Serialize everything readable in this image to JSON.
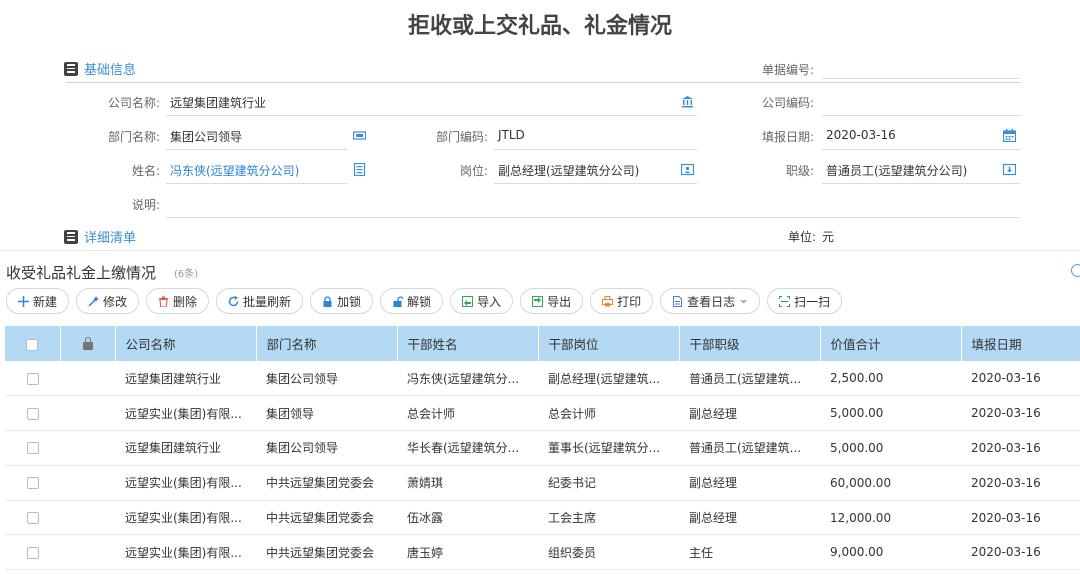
{
  "title": "拒收或上交礼品、礼金情况",
  "basic_section": {
    "label": "基础信息"
  },
  "detail_section": {
    "label": "详细清单"
  },
  "form": {
    "doc_no": {
      "label": "单据编号:",
      "value": ""
    },
    "company_name": {
      "label": "公司名称:",
      "value": "远望集团建筑行业"
    },
    "company_code": {
      "label": "公司编码:",
      "value": ""
    },
    "dept_name": {
      "label": "部门名称:",
      "value": "集团公司领导"
    },
    "dept_code": {
      "label": "部门编码:",
      "value": "JTLD"
    },
    "fill_date": {
      "label": "填报日期:",
      "value": "2020-03-16"
    },
    "person_name": {
      "label": "姓名:",
      "value": "冯东侠(远望建筑分公司)"
    },
    "position": {
      "label": "岗位:",
      "value": "副总经理(远望建筑分公司)"
    },
    "rank": {
      "label": "职级:",
      "value": "普通员工(远望建筑分公司)"
    },
    "remark": {
      "label": "说明:",
      "value": ""
    },
    "unit": {
      "label": "单位:",
      "value": "元"
    }
  },
  "list": {
    "title": "收受礼品礼金上缴情况",
    "count": "(6条)"
  },
  "toolbar": {
    "new": "新建",
    "edit": "修改",
    "delete": "删除",
    "refresh": "批量刷新",
    "lock": "加锁",
    "unlock": "解锁",
    "import": "导入",
    "export": "导出",
    "print": "打印",
    "log": "查看日志",
    "scan": "扫一扫"
  },
  "columns": [
    "公司名称",
    "部门名称",
    "干部姓名",
    "干部岗位",
    "干部职级",
    "价值合计",
    "填报日期"
  ],
  "rows": [
    [
      "远望集团建筑行业",
      "集团公司领导",
      "冯东侠(远望建筑分...",
      "副总经理(远望建筑...",
      "普通员工(远望建筑...",
      "2,500.00",
      "2020-03-16"
    ],
    [
      "远望实业(集团)有限...",
      "集团领导",
      "总会计师",
      "总会计师",
      "副总经理",
      "5,000.00",
      "2020-03-16"
    ],
    [
      "远望集团建筑行业",
      "集团公司领导",
      "华长春(远望建筑分...",
      "董事长(远望建筑分...",
      "普通员工(远望建筑...",
      "5,000.00",
      "2020-03-16"
    ],
    [
      "远望实业(集团)有限...",
      "中共远望集团党委会",
      "萧婧琪",
      "纪委书记",
      "副总经理",
      "60,000.00",
      "2020-03-16"
    ],
    [
      "远望实业(集团)有限...",
      "中共远望集团党委会",
      "伍冰露",
      "工会主席",
      "副总经理",
      "12,000.00",
      "2020-03-16"
    ],
    [
      "远望实业(集团)有限...",
      "中共远望集团党委会",
      "唐玉婷",
      "组织委员",
      "主任",
      "9,000.00",
      "2020-03-16"
    ]
  ],
  "colors": {
    "accent": "#3b8fd8",
    "header_bg": "#b4d9f5"
  }
}
